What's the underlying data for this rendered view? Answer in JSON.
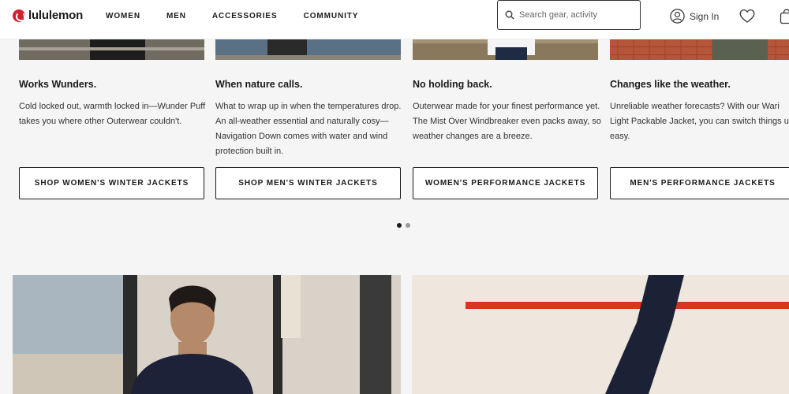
{
  "header": {
    "brand": "lululemon",
    "nav": [
      "WOMEN",
      "MEN",
      "ACCESSORIES",
      "COMMUNITY"
    ],
    "search_placeholder": "Search gear, activity",
    "sign_in": "Sign In"
  },
  "cards": [
    {
      "title": "Works Wunders.",
      "text": "Cold locked out, warmth locked in—Wunder Puff takes you where other Outerwear couldn't.",
      "button": "SHOP WOMEN'S WINTER JACKETS"
    },
    {
      "title": "When nature calls.",
      "text": "What to wrap up in when the temperatures drop. An all-weather essential and naturally cosy—Navigation Down comes with water and wind protection built in.",
      "button": "SHOP MEN'S WINTER JACKETS"
    },
    {
      "title": "No holding back.",
      "text": "Outerwear made for your finest performance yet. The Mist Over Windbreaker even packs away, so weather changes are a breeze.",
      "button": "WOMEN'S PERFORMANCE JACKETS"
    },
    {
      "title": "Changes like the weather.",
      "text": "Unreliable weather forecasts? With our Wari Light Packable Jacket, you can switch things up, easy.",
      "button": "MEN'S PERFORMANCE JACKETS"
    }
  ],
  "carousel": {
    "pages": 2,
    "active_page": 1
  },
  "colors": {
    "brand_red": "#d22030",
    "text": "#1a1a1a",
    "page_bg": "#f5f5f5"
  }
}
